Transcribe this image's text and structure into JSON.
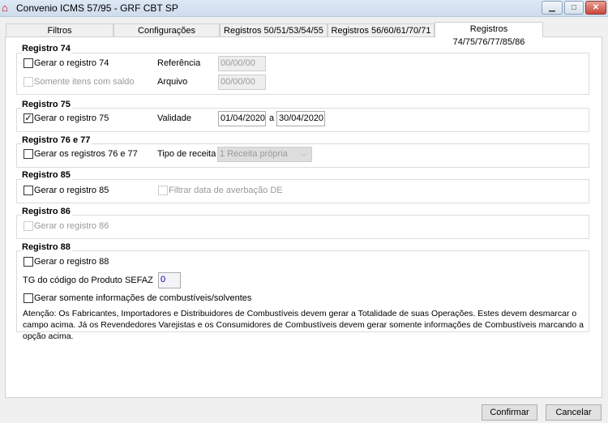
{
  "window": {
    "title": "Convenio ICMS 57/95 - GRF CBT SP",
    "minimize_icon": "minimize-icon",
    "maximize_icon": "maximize-icon",
    "close_icon": "close-icon"
  },
  "tabs": [
    {
      "label": "Filtros"
    },
    {
      "label": "Configurações"
    },
    {
      "label": "Registros 50/51/53/54/55"
    },
    {
      "label": "Registros 56/60/61/70/71"
    },
    {
      "label": "Registros 74/75/76/77/85/86",
      "active": true
    }
  ],
  "r74": {
    "title": "Registro 74",
    "gerar": "Gerar o registro 74",
    "gerar_checked": false,
    "somente": "Somente itens com saldo",
    "somente_checked": false,
    "referencia_label": "Referência",
    "referencia": "00/00/00",
    "arquivo_label": "Arquivo",
    "arquivo": "00/00/00"
  },
  "r75": {
    "title": "Registro 75",
    "gerar": "Gerar o registro 75",
    "gerar_checked": true,
    "validade_label": "Validade",
    "de": "01/04/2020",
    "a_label": "a",
    "ate": "30/04/2020"
  },
  "r76": {
    "title": "Registro 76 e 77",
    "gerar": "Gerar os registros 76 e 77",
    "gerar_checked": false,
    "tipo_label": "Tipo de receita",
    "tipo": "1 Receita própria"
  },
  "r85": {
    "title": "Registro 85",
    "gerar": "Gerar o registro 85",
    "gerar_checked": false,
    "filtrar": "Filtrar data de averbação DE",
    "filtrar_checked": false
  },
  "r86": {
    "title": "Registro 86",
    "gerar": "Gerar o registro 86",
    "gerar_checked": false
  },
  "r88": {
    "title": "Registro 88",
    "gerar": "Gerar o registro 88",
    "gerar_checked": false,
    "tg_label": "TG do código do Produto SEFAZ",
    "tg": "0",
    "somente": "Gerar somente informações de combustíveis/solventes",
    "somente_checked": false,
    "atencao": "Atenção: Os Fabricantes, Importadores e Distribuidores de Combustíveis devem gerar a Totalidade de suas Operações. Estes devem desmarcar o campo acima. Já os Revendedores Varejistas e os Consumidores de Combustíveis devem gerar somente informações de Combustíveis marcando a opção acima."
  },
  "buttons": {
    "confirmar": "Confirmar",
    "cancelar": "Cancelar"
  }
}
